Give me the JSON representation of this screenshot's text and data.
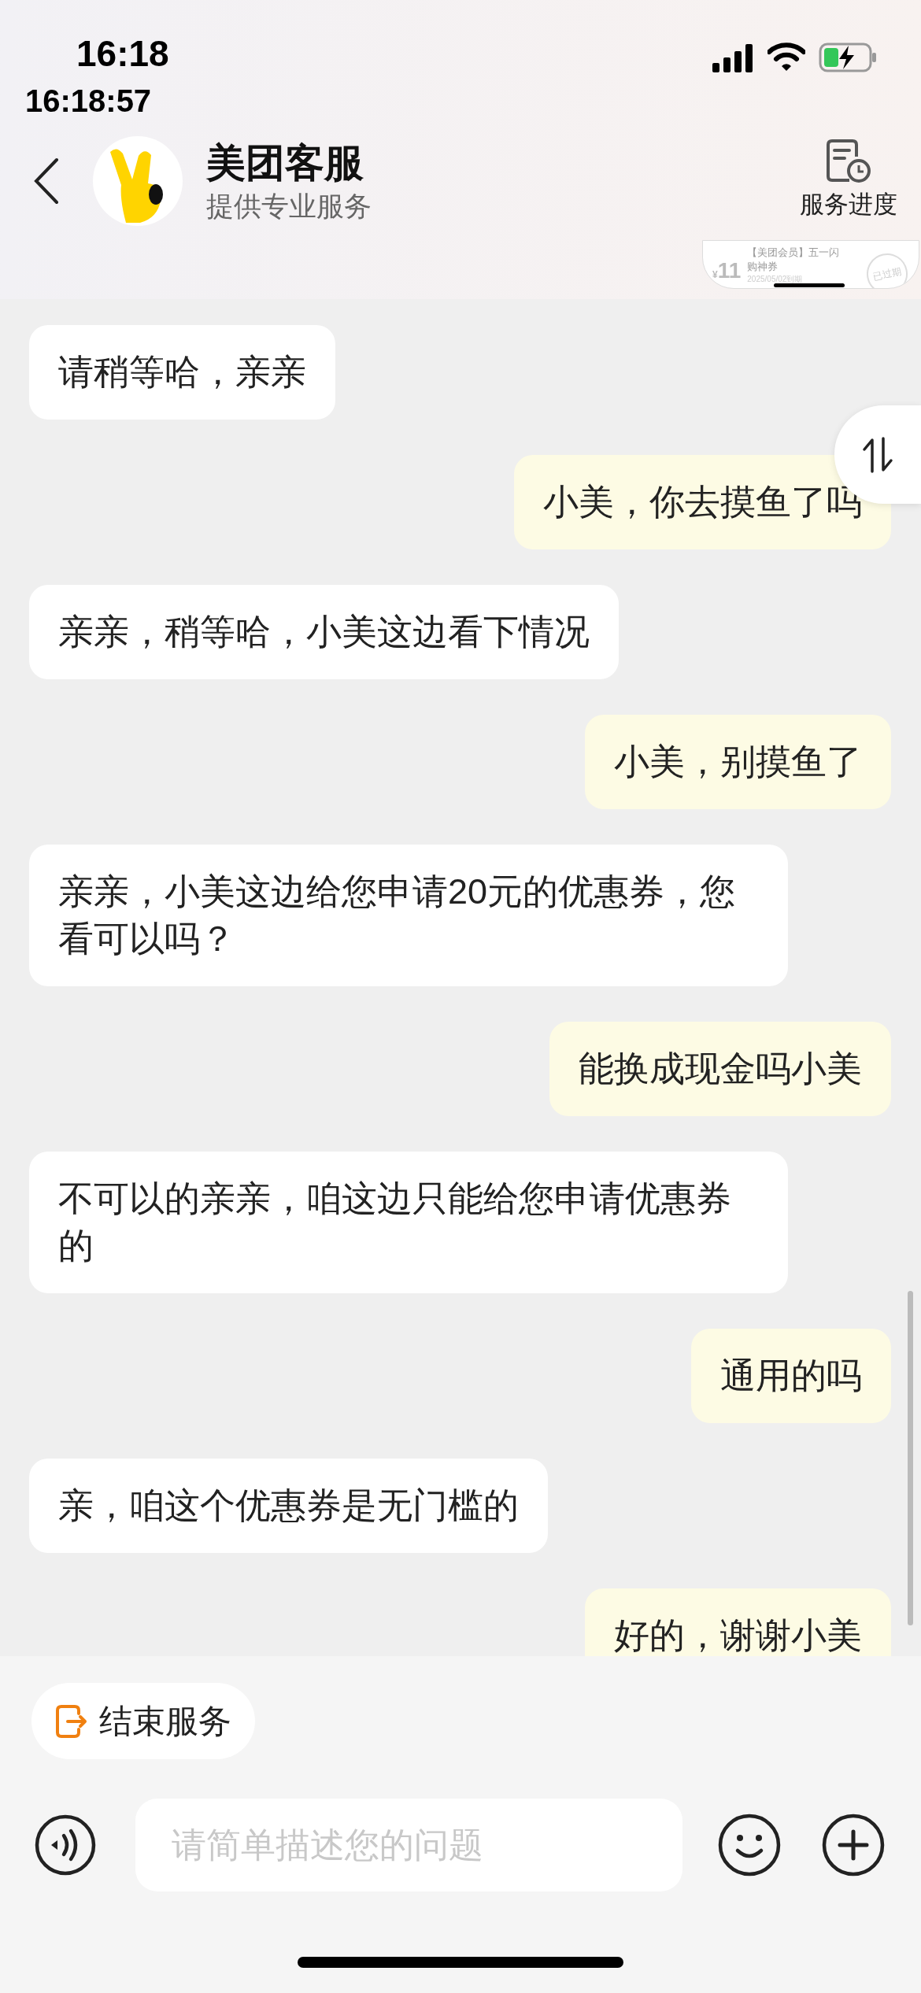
{
  "status_bar": {
    "time": "16:18",
    "clock": "16:18:57"
  },
  "header": {
    "title": "美团客服",
    "subtitle": "提供专业服务",
    "action": "服务进度"
  },
  "coupon_preview": {
    "currency": "¥",
    "amount": "11",
    "title": "【美团会员】五一闪购神券",
    "expiry": "2025/05/02到期",
    "stamp": "已过期"
  },
  "messages": [
    {
      "kind": "received",
      "text": "请稍等哈，亲亲"
    },
    {
      "kind": "sent",
      "text": "小美，你去摸鱼了吗"
    },
    {
      "kind": "received",
      "text": "亲亲，稍等哈，小美这边看下情况"
    },
    {
      "kind": "sent",
      "text": "小美，别摸鱼了"
    },
    {
      "kind": "received",
      "text": "亲亲，小美这边给您申请20元的优惠券，您看可以吗？"
    },
    {
      "kind": "sent",
      "text": "能换成现金吗小美"
    },
    {
      "kind": "received",
      "text": "不可以的亲亲，咱这边只能给您申请优惠券的"
    },
    {
      "kind": "sent",
      "text": "通用的吗"
    },
    {
      "kind": "received",
      "text": "亲，咱这个优惠券是无门槛的"
    },
    {
      "kind": "sent",
      "text": "好的，谢谢小美"
    }
  ],
  "quick_actions": [
    {
      "label": "结束服务"
    }
  ],
  "composer": {
    "placeholder": "请简单描述您的问题"
  }
}
